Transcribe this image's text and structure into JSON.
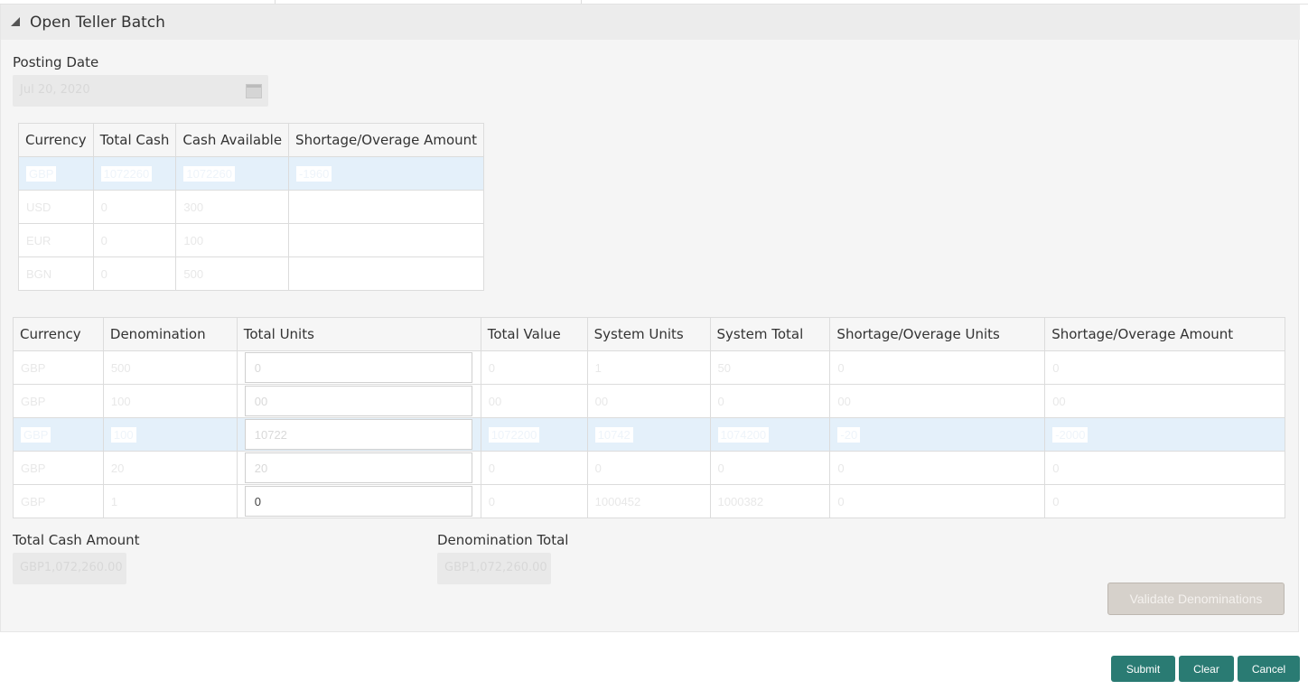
{
  "panel": {
    "title": "Open Teller Batch"
  },
  "posting_date": {
    "label": "Posting Date",
    "value": "Jul 20, 2020"
  },
  "summary_table": {
    "headers": [
      "Currency",
      "Total Cash",
      "Cash Available",
      "Shortage/Overage Amount"
    ],
    "rows": [
      [
        "GBP",
        "1072260",
        "1072260",
        "-1960"
      ],
      [
        "USD",
        "0",
        "300",
        ""
      ],
      [
        "EUR",
        "0",
        "100",
        ""
      ],
      [
        "BGN",
        "0",
        "500",
        ""
      ]
    ]
  },
  "denom_table": {
    "headers": [
      "Currency",
      "Denomination",
      "Total Units",
      "Total Value",
      "System Units",
      "System Total",
      "Shortage/Overage Units",
      "Shortage/Overage Amount"
    ],
    "rows": [
      [
        "GBP",
        "500",
        "0",
        "0",
        "1",
        "50",
        "0",
        "0"
      ],
      [
        "GBP",
        "100",
        "00",
        "00",
        "00",
        "0",
        "00",
        "00"
      ],
      [
        "GBP",
        "100",
        "10722",
        "1072200",
        "10742",
        "1074200",
        "-20",
        "-2000"
      ],
      [
        "GBP",
        "20",
        "20",
        "0",
        "0",
        "0",
        "0",
        "0"
      ],
      [
        "GBP",
        "1",
        "0",
        "0",
        "1000452",
        "1000382",
        "0",
        "0"
      ]
    ]
  },
  "totals": {
    "cash_label": "Total Cash Amount",
    "cash_value": "GBP1,072,260.00",
    "denom_label": "Denomination Total",
    "denom_value": "GBP1,072,260.00"
  },
  "actions": {
    "validate": "Validate Denominations",
    "submit": "Submit",
    "clear": "Clear",
    "cancel": "Cancel"
  },
  "colors": {
    "primary_button": "#2a7b73",
    "selected_row": "#e4f0fa",
    "disabled_button": "#d6d1cb"
  }
}
